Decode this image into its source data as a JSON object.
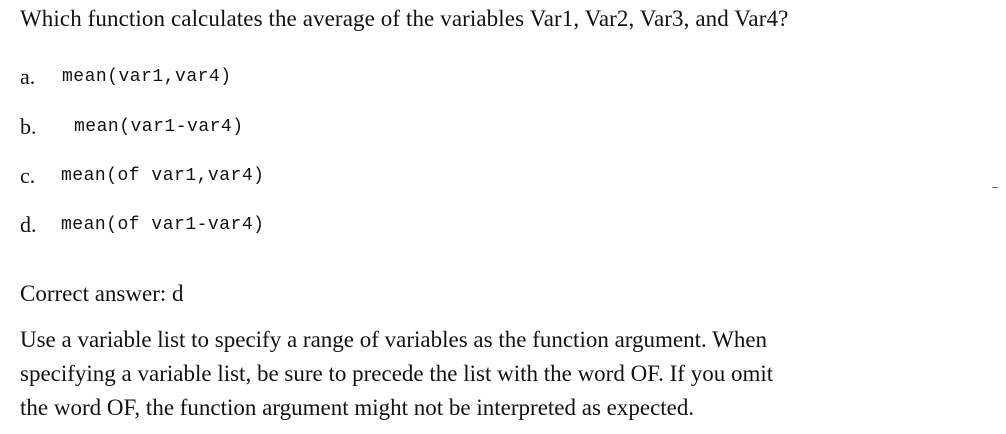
{
  "question": "Which function calculates the average of the variables Var1, Var2, Var3, and Var4?",
  "options": [
    {
      "letter": "a.",
      "code": "mean(var1,var4)"
    },
    {
      "letter": "b.",
      "code": "mean(var1-var4)"
    },
    {
      "letter": "c.",
      "code": "mean(of var1,var4)"
    },
    {
      "letter": "d.",
      "code": "mean(of var1-var4)"
    }
  ],
  "correct_answer": "Correct answer: d",
  "explanation_lines": [
    "Use a variable list to specify a range of variables as the function argument. When",
    "specifying a variable list, be sure to precede the list with the word OF. If you omit",
    "the word OF, the function argument might not be interpreted as expected."
  ]
}
